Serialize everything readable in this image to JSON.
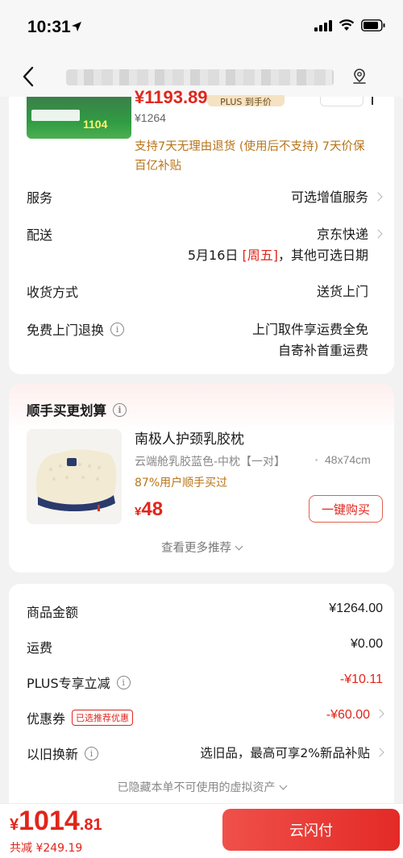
{
  "status": {
    "time": "10:31"
  },
  "top_card": {
    "thumb_price": "1104",
    "price_fragment": "¥1193.89",
    "plus_label": "PLUS 到手价",
    "original_price": "¥1264",
    "policy_line1": "支持7天无理由退货 (使用后不支持)  7天价保",
    "policy_line2": "百亿补贴",
    "rows": {
      "service": {
        "label": "服务",
        "value": "可选增值服务"
      },
      "delivery": {
        "label": "配送",
        "value": "京东快递",
        "date_prefix": "5月16日",
        "date_weekday": "[周五]",
        "date_suffix": "，其他可选日期"
      },
      "receive": {
        "label": "收货方式",
        "value": "送货上门"
      },
      "return": {
        "label": "免费上门退换",
        "value_line1": "上门取件享运费全免",
        "value_line2": "自寄补首重运费"
      }
    }
  },
  "recommend": {
    "title": "顺手买更划算",
    "product_name": "南极人护颈乳胶枕",
    "spec": "云端舱乳胶蓝色-中枕【一对】",
    "size": "48x74cm",
    "percent": "87%用户顺手买过",
    "currency": "¥",
    "price": "48",
    "buy_label": "一键购买",
    "more_label": "查看更多推荐"
  },
  "summary": {
    "rows": [
      {
        "label": "商品金额",
        "value": "¥1264.00"
      },
      {
        "label": "运费",
        "value": "¥0.00"
      },
      {
        "label": "PLUS专享立减",
        "value": "-¥10.11"
      },
      {
        "label": "优惠券",
        "badge": "已选推荐优惠",
        "value": "-¥60.00"
      },
      {
        "label": "以旧换新",
        "value": "选旧品，最高可享2%新品补贴"
      }
    ],
    "hidden_note": "已隐藏本单不可使用的虚拟资产"
  },
  "bottom": {
    "currency": "¥",
    "total_int": "1014",
    "total_dec": ".81",
    "saved": "共减 ¥249.19",
    "pay_label": "云闪付"
  },
  "colors": {
    "accent": "#e1251b",
    "gold": "#b8741a"
  }
}
